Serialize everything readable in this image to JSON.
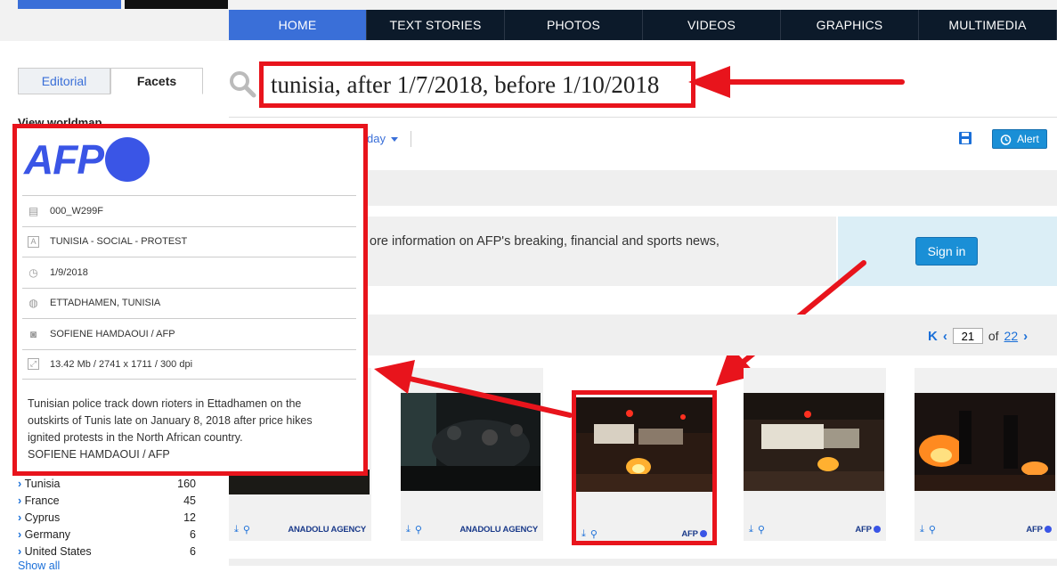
{
  "nav": {
    "tabs": [
      "HOME",
      "TEXT STORIES",
      "PHOTOS",
      "VIDEOS",
      "GRAPHICS",
      "MULTIMEDIA"
    ],
    "active": "HOME"
  },
  "sidebar": {
    "tabs": [
      "Editorial",
      "Facets"
    ],
    "active_tab": "Facets",
    "worldmap_label": "View worldmap",
    "countries": [
      {
        "name": "Tunisia",
        "count": "160"
      },
      {
        "name": "France",
        "count": "45"
      },
      {
        "name": "Cyprus",
        "count": "12"
      },
      {
        "name": "Germany",
        "count": "6"
      },
      {
        "name": "United States",
        "count": "6"
      }
    ],
    "show_all": "Show all"
  },
  "search": {
    "query": "tunisia, after 1/7/2018, before 1/10/2018"
  },
  "toolbar": {
    "sort_label": "day",
    "alert_label": "Alert"
  },
  "info": {
    "text": "ore information on AFP's breaking, financial and sports news,",
    "signin_label": "Sign in"
  },
  "pager": {
    "current": "21",
    "of_label": "of",
    "total": "22"
  },
  "cards": [
    {
      "brand": "ANADOLU AGENCY"
    },
    {
      "brand": "ANADOLU AGENCY"
    },
    {
      "brand": "AFP"
    },
    {
      "brand": "AFP"
    },
    {
      "brand": "AFP"
    }
  ],
  "popup": {
    "logo": "AFP",
    "id": "000_W299F",
    "title": "TUNISIA - SOCIAL - PROTEST",
    "date": "1/9/2018",
    "location": "ETTADHAMEN, TUNISIA",
    "credit": "SOFIENE HAMDAOUI / AFP",
    "specs": "13.42 Mb / 2741 x 1711 / 300 dpi",
    "caption": "Tunisian police track down rioters in Ettadhamen on the outskirts of Tunis late on January 8, 2018 after price hikes ignited protests in the North African country.",
    "caption_credit": "SOFIENE HAMDAOUI / AFP"
  },
  "colors": {
    "accent": "#3a6fd8",
    "highlight": "#e8141c",
    "nav_bg": "#0c1a2a",
    "afp_blue": "#3a55e6"
  }
}
